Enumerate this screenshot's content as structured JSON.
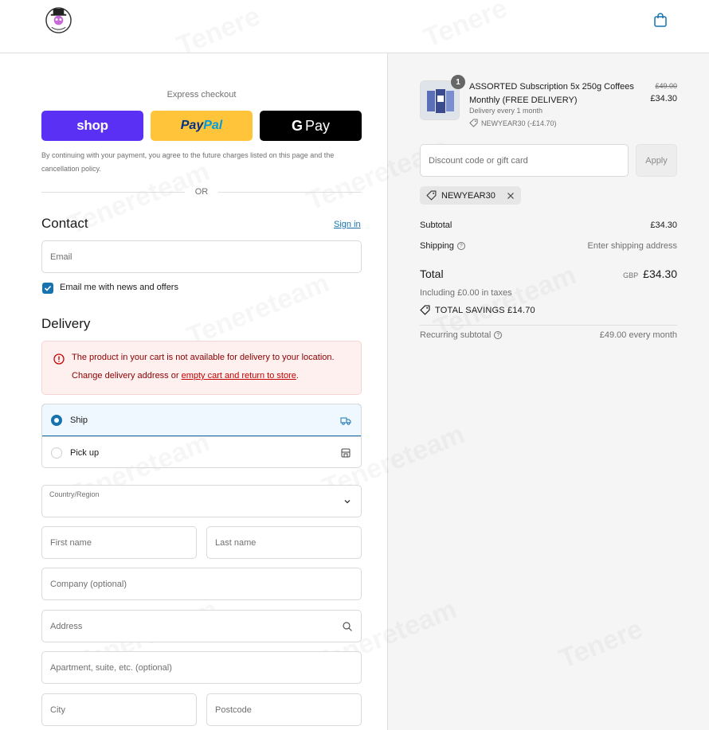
{
  "header": {
    "logo_icon": "brand-logo-icon",
    "cart_icon": "shopping-bag-icon"
  },
  "express": {
    "title": "Express checkout",
    "shop_label": "shop",
    "paypal_label_1": "Pay",
    "paypal_label_2": "Pal",
    "gpay_g": "G",
    "gpay_label": "Pay",
    "disclaimer": "By continuing with your payment, you agree to the future charges listed on this page and the cancellation policy.",
    "or_text": "OR"
  },
  "contact": {
    "title": "Contact",
    "sign_in": "Sign in",
    "email_placeholder": "Email",
    "newsletter_label": "Email me with news and offers",
    "newsletter_checked": true
  },
  "delivery": {
    "title": "Delivery",
    "error_line1": "The product in your cart is not available for delivery to your location.",
    "error_line2_prefix": "Change delivery address or ",
    "error_link": "empty cart and return to store",
    "error_line2_suffix": ".",
    "options": [
      {
        "label": "Ship",
        "selected": true,
        "icon": "truck-icon"
      },
      {
        "label": "Pick up",
        "selected": false,
        "icon": "store-icon"
      }
    ],
    "country_label": "Country/Region",
    "first_name": "First name",
    "last_name": "Last name",
    "company": "Company (optional)",
    "address": "Address",
    "apartment": "Apartment, suite, etc. (optional)",
    "city": "City",
    "postcode": "Postcode"
  },
  "summary": {
    "product": {
      "quantity": "1",
      "title": "ASSORTED Subscription 5x 250g Coffees Monthly (FREE DELIVERY)",
      "delivery": "Delivery every 1 month",
      "discount": "NEWYEAR30 (-£14.70)",
      "old_price": "£49.00",
      "price": "£34.30"
    },
    "discount_placeholder": "Discount code or gift card",
    "apply_label": "Apply",
    "applied_code": "NEWYEAR30",
    "subtotal_label": "Subtotal",
    "subtotal_value": "£34.30",
    "shipping_label": "Shipping",
    "shipping_value": "Enter shipping address",
    "total_label": "Total",
    "currency": "GBP",
    "total_value": "£34.30",
    "tax_line": "Including £0.00 in taxes",
    "savings": "TOTAL SAVINGS  £14.70",
    "recurring_label": "Recurring subtotal",
    "recurring_value": "£49.00 every month"
  },
  "colors": {
    "accent": "#1773b0",
    "shop_purple": "#5a31f4",
    "paypal_yellow": "#ffc439",
    "error_red": "#c40000"
  }
}
